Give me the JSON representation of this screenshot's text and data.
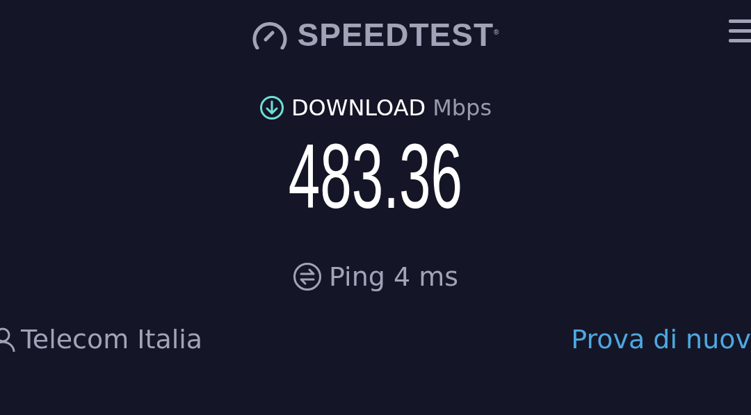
{
  "header": {
    "logo": "SPEEDTEST$^{®}$"
  },
  "result": {
    "label": "DOWNLOAD",
    "unit": "Mbps",
    "value": "483.36"
  },
  "ping": {
    "label": "Ping 4 ms"
  },
  "footer": {
    "provider": "Telecom Italia",
    "action": "Prova di nuov"
  }
}
